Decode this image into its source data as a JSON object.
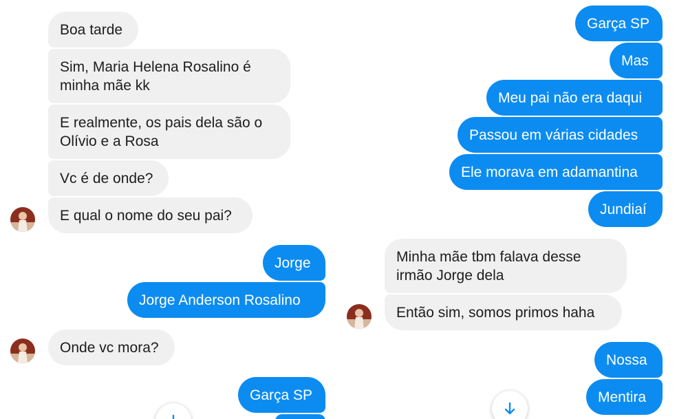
{
  "left": {
    "messages": [
      {
        "text": "Boa tarde",
        "dir": "in"
      },
      {
        "text": "Sim, Maria Helena Rosalino é\nminha mãe kk",
        "dir": "in"
      },
      {
        "text": "E realmente, os pais dela são o\nOlívio e a Rosa",
        "dir": "in"
      },
      {
        "text": "Vc é de onde?",
        "dir": "in"
      },
      {
        "text": "E qual o nome do seu pai?",
        "dir": "in"
      },
      {
        "text": "Jorge",
        "dir": "out"
      },
      {
        "text": "Jorge Anderson Rosalino",
        "dir": "out"
      },
      {
        "text": "Onde vc mora?",
        "dir": "in"
      },
      {
        "text": "Garça SP",
        "dir": "out"
      }
    ]
  },
  "right": {
    "messages": [
      {
        "text": "Garça SP",
        "dir": "out"
      },
      {
        "text": "Mas",
        "dir": "out"
      },
      {
        "text": "Meu pai não era daqui",
        "dir": "out"
      },
      {
        "text": "Passou em várias cidades",
        "dir": "out"
      },
      {
        "text": "Ele morava em adamantina",
        "dir": "out"
      },
      {
        "text": "Jundiaí",
        "dir": "out"
      },
      {
        "text": "Minha mãe tbm falava desse\nirmão Jorge dela",
        "dir": "in"
      },
      {
        "text": "Então sim, somos primos haha",
        "dir": "in"
      },
      {
        "text": "Nossa",
        "dir": "out"
      },
      {
        "text": "Mentira",
        "dir": "out"
      }
    ]
  },
  "colors": {
    "outgoing_bubble": "#0c8cf0",
    "incoming_bubble": "#f0f0f0",
    "incoming_text": "#1c1c1c",
    "scroll_arrow": "#0c8cf0"
  },
  "icons": {
    "avatar": "contact-avatar-icon",
    "scroll": "arrow-down-icon"
  }
}
